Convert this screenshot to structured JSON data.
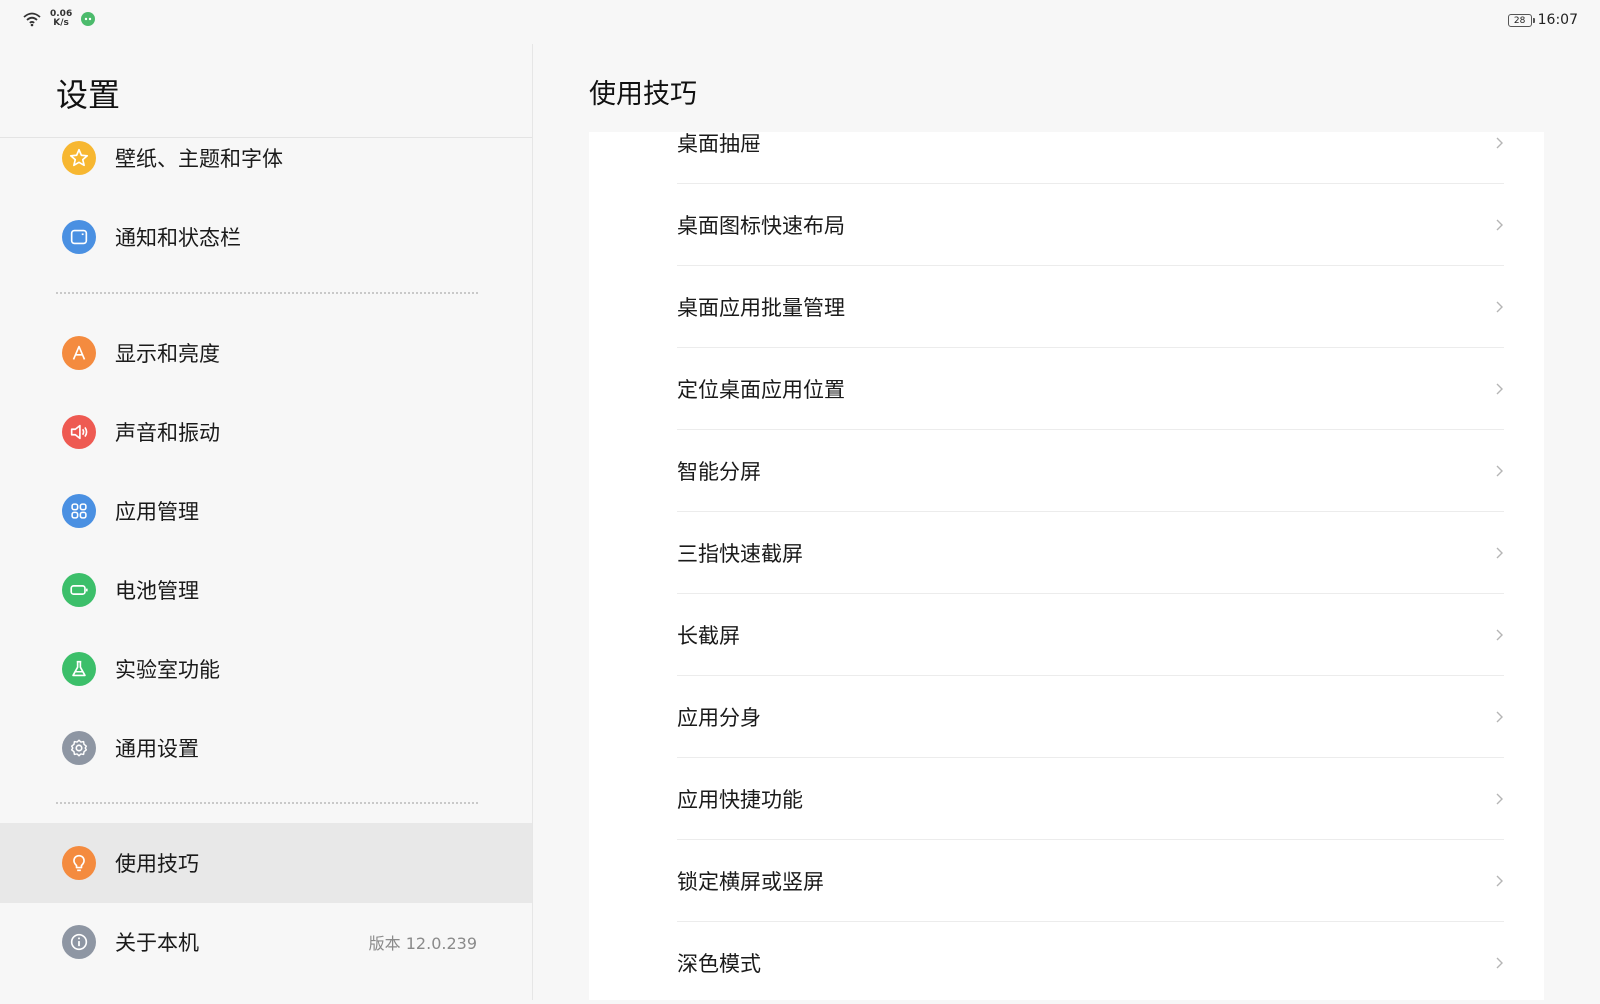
{
  "status_bar": {
    "net_speed_value": "0.06",
    "net_speed_unit": "K/s",
    "battery": "28",
    "time": "16:07"
  },
  "left_panel": {
    "title": "设置",
    "items": [
      {
        "label": "壁纸、主题和字体",
        "icon": "star-icon",
        "color": "#f7b731"
      },
      {
        "label": "通知和状态栏",
        "icon": "notification-icon",
        "color": "#4a90e2"
      },
      {
        "label": "显示和亮度",
        "icon": "display-icon",
        "color": "#f48b3f"
      },
      {
        "label": "声音和振动",
        "icon": "speaker-icon",
        "color": "#ee5a52"
      },
      {
        "label": "应用管理",
        "icon": "apps-grid-icon",
        "color": "#4a90e2"
      },
      {
        "label": "电池管理",
        "icon": "battery-icon",
        "color": "#3cbf6a"
      },
      {
        "label": "实验室功能",
        "icon": "flask-icon",
        "color": "#3cbf6a"
      },
      {
        "label": "通用设置",
        "icon": "gear-icon",
        "color": "#8e96a3"
      },
      {
        "label": "使用技巧",
        "icon": "lightbulb-icon",
        "color": "#f48b3f",
        "selected": true
      },
      {
        "label": "关于本机",
        "icon": "info-icon",
        "color": "#8e96a3",
        "value": "版本 12.0.239"
      }
    ]
  },
  "right_panel": {
    "title": "使用技巧",
    "items": [
      {
        "label": "桌面抽屉"
      },
      {
        "label": "桌面图标快速布局"
      },
      {
        "label": "桌面应用批量管理"
      },
      {
        "label": "定位桌面应用位置"
      },
      {
        "label": "智能分屏"
      },
      {
        "label": "三指快速截屏"
      },
      {
        "label": "长截屏"
      },
      {
        "label": "应用分身"
      },
      {
        "label": "应用快捷功能"
      },
      {
        "label": "锁定横屏或竖屏"
      },
      {
        "label": "深色模式"
      }
    ]
  }
}
